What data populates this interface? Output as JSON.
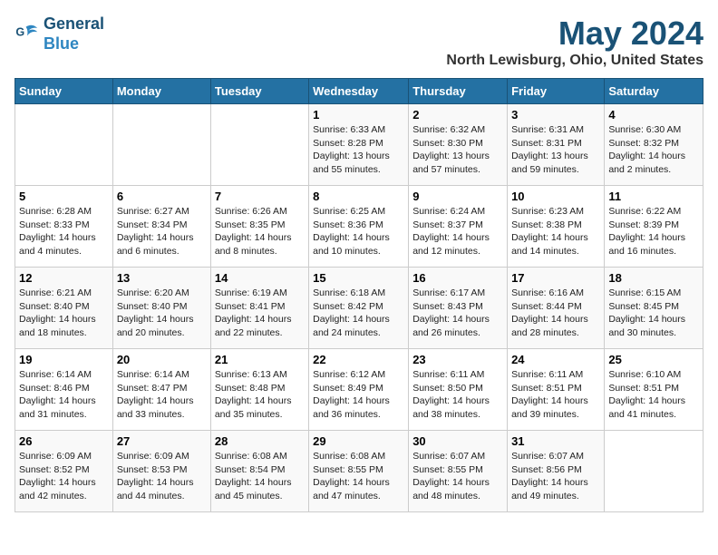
{
  "logo": {
    "line1": "General",
    "line2": "Blue"
  },
  "title": "May 2024",
  "subtitle": "North Lewisburg, Ohio, United States",
  "days_of_week": [
    "Sunday",
    "Monday",
    "Tuesday",
    "Wednesday",
    "Thursday",
    "Friday",
    "Saturday"
  ],
  "weeks": [
    [
      {
        "day": "",
        "info": ""
      },
      {
        "day": "",
        "info": ""
      },
      {
        "day": "",
        "info": ""
      },
      {
        "day": "1",
        "info": "Sunrise: 6:33 AM\nSunset: 8:28 PM\nDaylight: 13 hours\nand 55 minutes."
      },
      {
        "day": "2",
        "info": "Sunrise: 6:32 AM\nSunset: 8:30 PM\nDaylight: 13 hours\nand 57 minutes."
      },
      {
        "day": "3",
        "info": "Sunrise: 6:31 AM\nSunset: 8:31 PM\nDaylight: 13 hours\nand 59 minutes."
      },
      {
        "day": "4",
        "info": "Sunrise: 6:30 AM\nSunset: 8:32 PM\nDaylight: 14 hours\nand 2 minutes."
      }
    ],
    [
      {
        "day": "5",
        "info": "Sunrise: 6:28 AM\nSunset: 8:33 PM\nDaylight: 14 hours\nand 4 minutes."
      },
      {
        "day": "6",
        "info": "Sunrise: 6:27 AM\nSunset: 8:34 PM\nDaylight: 14 hours\nand 6 minutes."
      },
      {
        "day": "7",
        "info": "Sunrise: 6:26 AM\nSunset: 8:35 PM\nDaylight: 14 hours\nand 8 minutes."
      },
      {
        "day": "8",
        "info": "Sunrise: 6:25 AM\nSunset: 8:36 PM\nDaylight: 14 hours\nand 10 minutes."
      },
      {
        "day": "9",
        "info": "Sunrise: 6:24 AM\nSunset: 8:37 PM\nDaylight: 14 hours\nand 12 minutes."
      },
      {
        "day": "10",
        "info": "Sunrise: 6:23 AM\nSunset: 8:38 PM\nDaylight: 14 hours\nand 14 minutes."
      },
      {
        "day": "11",
        "info": "Sunrise: 6:22 AM\nSunset: 8:39 PM\nDaylight: 14 hours\nand 16 minutes."
      }
    ],
    [
      {
        "day": "12",
        "info": "Sunrise: 6:21 AM\nSunset: 8:40 PM\nDaylight: 14 hours\nand 18 minutes."
      },
      {
        "day": "13",
        "info": "Sunrise: 6:20 AM\nSunset: 8:40 PM\nDaylight: 14 hours\nand 20 minutes."
      },
      {
        "day": "14",
        "info": "Sunrise: 6:19 AM\nSunset: 8:41 PM\nDaylight: 14 hours\nand 22 minutes."
      },
      {
        "day": "15",
        "info": "Sunrise: 6:18 AM\nSunset: 8:42 PM\nDaylight: 14 hours\nand 24 minutes."
      },
      {
        "day": "16",
        "info": "Sunrise: 6:17 AM\nSunset: 8:43 PM\nDaylight: 14 hours\nand 26 minutes."
      },
      {
        "day": "17",
        "info": "Sunrise: 6:16 AM\nSunset: 8:44 PM\nDaylight: 14 hours\nand 28 minutes."
      },
      {
        "day": "18",
        "info": "Sunrise: 6:15 AM\nSunset: 8:45 PM\nDaylight: 14 hours\nand 30 minutes."
      }
    ],
    [
      {
        "day": "19",
        "info": "Sunrise: 6:14 AM\nSunset: 8:46 PM\nDaylight: 14 hours\nand 31 minutes."
      },
      {
        "day": "20",
        "info": "Sunrise: 6:14 AM\nSunset: 8:47 PM\nDaylight: 14 hours\nand 33 minutes."
      },
      {
        "day": "21",
        "info": "Sunrise: 6:13 AM\nSunset: 8:48 PM\nDaylight: 14 hours\nand 35 minutes."
      },
      {
        "day": "22",
        "info": "Sunrise: 6:12 AM\nSunset: 8:49 PM\nDaylight: 14 hours\nand 36 minutes."
      },
      {
        "day": "23",
        "info": "Sunrise: 6:11 AM\nSunset: 8:50 PM\nDaylight: 14 hours\nand 38 minutes."
      },
      {
        "day": "24",
        "info": "Sunrise: 6:11 AM\nSunset: 8:51 PM\nDaylight: 14 hours\nand 39 minutes."
      },
      {
        "day": "25",
        "info": "Sunrise: 6:10 AM\nSunset: 8:51 PM\nDaylight: 14 hours\nand 41 minutes."
      }
    ],
    [
      {
        "day": "26",
        "info": "Sunrise: 6:09 AM\nSunset: 8:52 PM\nDaylight: 14 hours\nand 42 minutes."
      },
      {
        "day": "27",
        "info": "Sunrise: 6:09 AM\nSunset: 8:53 PM\nDaylight: 14 hours\nand 44 minutes."
      },
      {
        "day": "28",
        "info": "Sunrise: 6:08 AM\nSunset: 8:54 PM\nDaylight: 14 hours\nand 45 minutes."
      },
      {
        "day": "29",
        "info": "Sunrise: 6:08 AM\nSunset: 8:55 PM\nDaylight: 14 hours\nand 47 minutes."
      },
      {
        "day": "30",
        "info": "Sunrise: 6:07 AM\nSunset: 8:55 PM\nDaylight: 14 hours\nand 48 minutes."
      },
      {
        "day": "31",
        "info": "Sunrise: 6:07 AM\nSunset: 8:56 PM\nDaylight: 14 hours\nand 49 minutes."
      },
      {
        "day": "",
        "info": ""
      }
    ]
  ]
}
